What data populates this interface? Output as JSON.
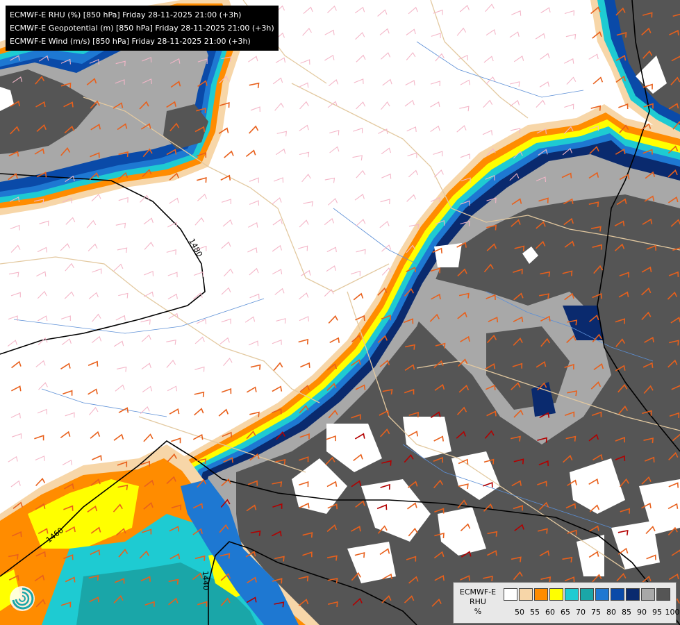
{
  "titles": [
    "ECMWF-E RHU (%) [850 hPa] Friday 28-11-2025 21:00 (+3h)",
    "ECMWF-E Geopotential (m) [850 hPa] Friday 28-11-2025 21:00 (+3h)",
    "ECMWF-E Wind (m/s) [850 hPa] Friday 28-11-2025 21:00 (+3h)"
  ],
  "legend": {
    "title_line1": "ECMWF-E",
    "title_line2": "RHU",
    "title_line3": "%",
    "ticks": [
      "50",
      "55",
      "60",
      "65",
      "70",
      "75",
      "80",
      "85",
      "90",
      "95",
      "100"
    ],
    "colors": [
      "#ffffff",
      "#f7d6a8",
      "#ff8c00",
      "#ffff00",
      "#1ecbd2",
      "#1aa6a8",
      "#1e78d2",
      "#0a4aa8",
      "#0a2a6e",
      "#a8a8a8",
      "#555555"
    ]
  },
  "contours": [
    {
      "label": "1480"
    },
    {
      "label": "1460"
    },
    {
      "label": "1440"
    }
  ],
  "icons": {
    "logo": "ecmwf-swirl-icon"
  }
}
